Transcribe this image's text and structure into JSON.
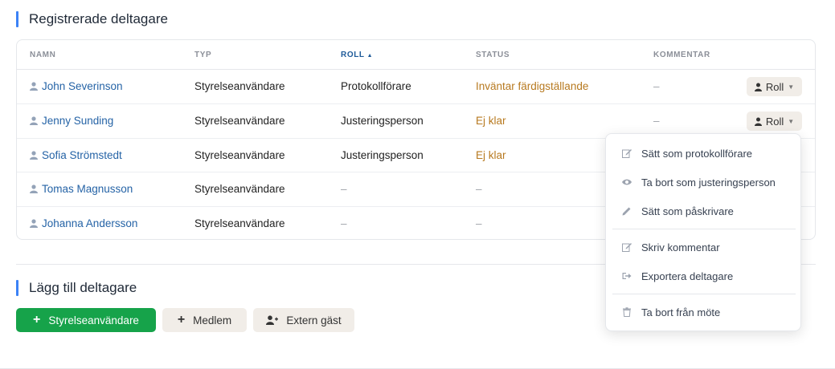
{
  "registered": {
    "title": "Registrerade deltagare",
    "columns": {
      "name": "NAMN",
      "type": "TYP",
      "role": "ROLL",
      "status": "STATUS",
      "comment": "KOMMENTAR"
    },
    "rows": [
      {
        "name": "John Severinson",
        "type": "Styrelseanvändare",
        "role": "Protokollförare",
        "status": "Inväntar färdigställande",
        "comment": "–",
        "roll_label": "Roll"
      },
      {
        "name": "Jenny Sunding",
        "type": "Styrelseanvändare",
        "role": "Justeringsperson",
        "status": "Ej klar",
        "comment": "–",
        "roll_label": "Roll"
      },
      {
        "name": "Sofia Strömstedt",
        "type": "Styrelseanvändare",
        "role": "Justeringsperson",
        "status": "Ej klar",
        "comment": ""
      },
      {
        "name": "Tomas Magnusson",
        "type": "Styrelseanvändare",
        "role": "–",
        "status": "–",
        "comment": ""
      },
      {
        "name": "Johanna Andersson",
        "type": "Styrelseanvändare",
        "role": "–",
        "status": "–",
        "comment": ""
      }
    ]
  },
  "dropdown": {
    "items": [
      {
        "label": "Sätt som protokollförare",
        "icon": "edit-icon"
      },
      {
        "label": "Ta bort som justeringsperson",
        "icon": "eye-icon"
      },
      {
        "label": "Sätt som påskrivare",
        "icon": "pencil-icon"
      },
      {
        "label": "Skriv kommentar",
        "icon": "edit-icon"
      },
      {
        "label": "Exportera deltagare",
        "icon": "export-icon"
      },
      {
        "label": "Ta bort från möte",
        "icon": "trash-icon"
      }
    ]
  },
  "add": {
    "title": "Lägg till deltagare",
    "board_user_label": "Styrelseanvändare",
    "member_label": "Medlem",
    "guest_label": "Extern gäst"
  },
  "colors": {
    "accent": "#3b82f6",
    "link": "#2563a6",
    "warning": "#b7791f",
    "primary_button": "#16a34a",
    "secondary_button": "#f1ede8"
  }
}
